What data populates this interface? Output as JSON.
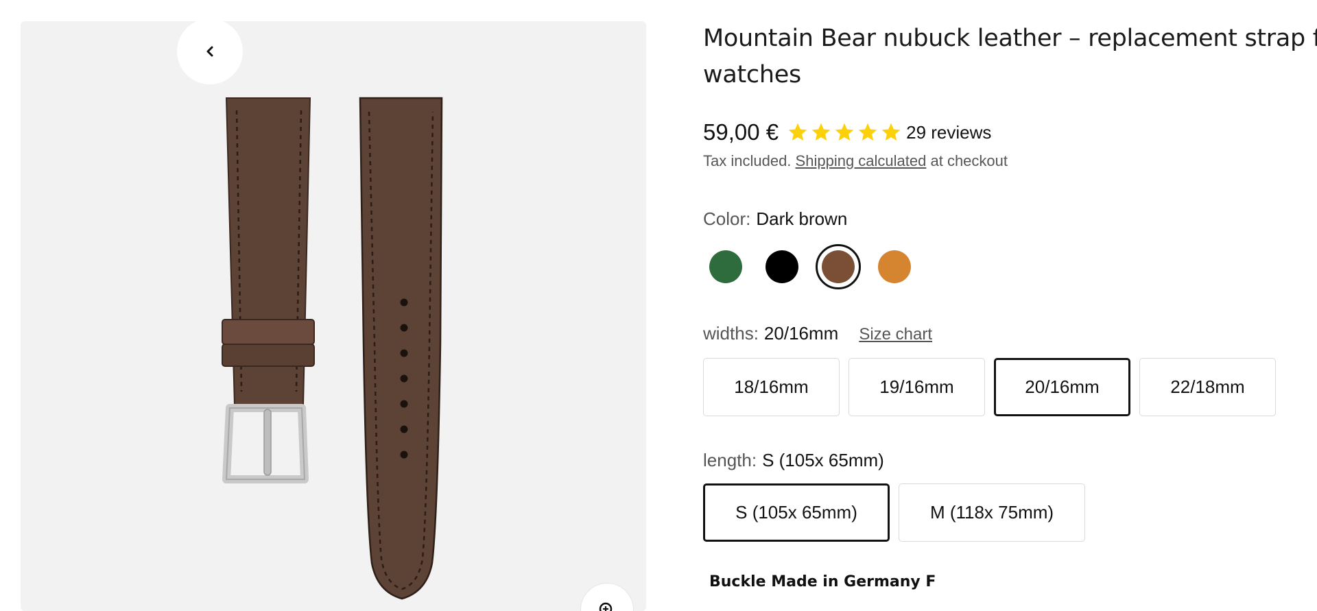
{
  "product": {
    "title": "Mountain Bear nubuck leather – replacement strap for watches",
    "price": "59,00 €",
    "rating_stars": 5,
    "reviews": "29 reviews",
    "tax_prefix": "Tax included.",
    "shipping_link": "Shipping calculated",
    "tax_suffix": "at checkout"
  },
  "gallery": {
    "prev_icon": "chevron-left-icon",
    "zoom_icon": "zoom-in-icon",
    "strap_color": "#5d4236"
  },
  "color": {
    "label": "Color:",
    "selected": "Dark brown",
    "swatches": [
      {
        "name": "Green",
        "color": "#2e6b3d"
      },
      {
        "name": "Black",
        "color": "#000000"
      },
      {
        "name": "Dark brown",
        "color": "#7a4f36",
        "selected": true
      },
      {
        "name": "Orange",
        "color": "#d5842f"
      }
    ]
  },
  "widths": {
    "label": "widths:",
    "selected": "20/16mm",
    "size_chart": "Size chart",
    "options": [
      {
        "label": "18/16mm"
      },
      {
        "label": "19/16mm"
      },
      {
        "label": "20/16mm",
        "selected": true
      },
      {
        "label": "22/18mm"
      }
    ]
  },
  "length": {
    "label": "length:",
    "selected": "S (105x 65mm)",
    "options": [
      {
        "label": "S (105x 65mm)",
        "selected": true
      },
      {
        "label": "M (118x 75mm)"
      }
    ]
  },
  "buckle": {
    "label": "Buckle Made in Germany F"
  },
  "colors": {
    "star": "#fdd10a",
    "selected_border": "#111111"
  }
}
